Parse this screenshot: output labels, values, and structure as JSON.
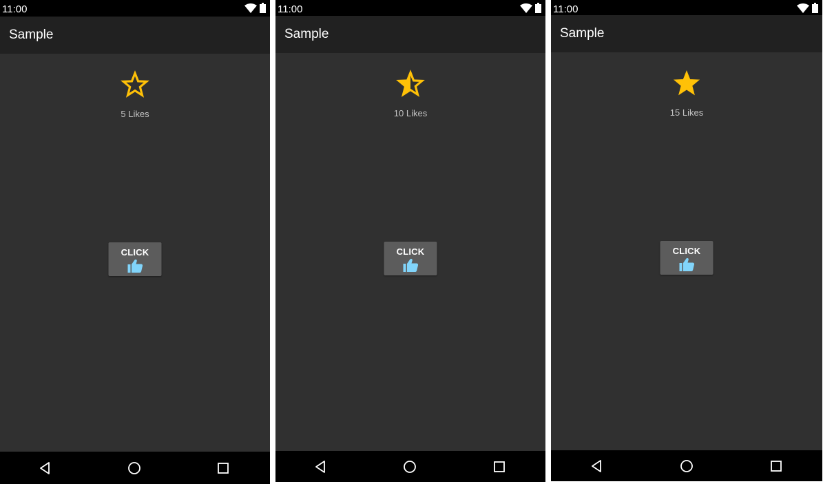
{
  "phones": [
    {
      "status": {
        "time": "11:00",
        "wifi_icon": "wifi-icon",
        "battery_icon": "battery-icon"
      },
      "appbar": {
        "title": "Sample"
      },
      "content": {
        "star_icon": "star-outline-icon",
        "star_state": "empty",
        "likes_text": "5 Likes"
      },
      "button": {
        "label": "CLICK",
        "icon": "thumbs-up-icon"
      },
      "nav": {
        "back": "back-icon",
        "home": "home-icon",
        "recents": "recents-icon"
      }
    },
    {
      "status": {
        "time": "11:00",
        "wifi_icon": "wifi-icon",
        "battery_icon": "battery-icon"
      },
      "appbar": {
        "title": "Sample"
      },
      "content": {
        "star_icon": "star-half-icon",
        "star_state": "half",
        "likes_text": "10 Likes"
      },
      "button": {
        "label": "CLICK",
        "icon": "thumbs-up-icon"
      },
      "nav": {
        "back": "back-icon",
        "home": "home-icon",
        "recents": "recents-icon"
      }
    },
    {
      "status": {
        "time": "11:00",
        "wifi_icon": "wifi-icon",
        "battery_icon": "battery-icon"
      },
      "appbar": {
        "title": "Sample"
      },
      "content": {
        "star_icon": "star-filled-icon",
        "star_state": "full",
        "likes_text": "15 Likes"
      },
      "button": {
        "label": "CLICK",
        "icon": "thumbs-up-icon"
      },
      "nav": {
        "back": "back-icon",
        "home": "home-icon",
        "recents": "recents-icon"
      }
    }
  ],
  "colors": {
    "star": "#FFC107",
    "thumb": "#81D4FA",
    "background": "#303030",
    "appbar": "#212121",
    "button": "#5C5C5C"
  }
}
